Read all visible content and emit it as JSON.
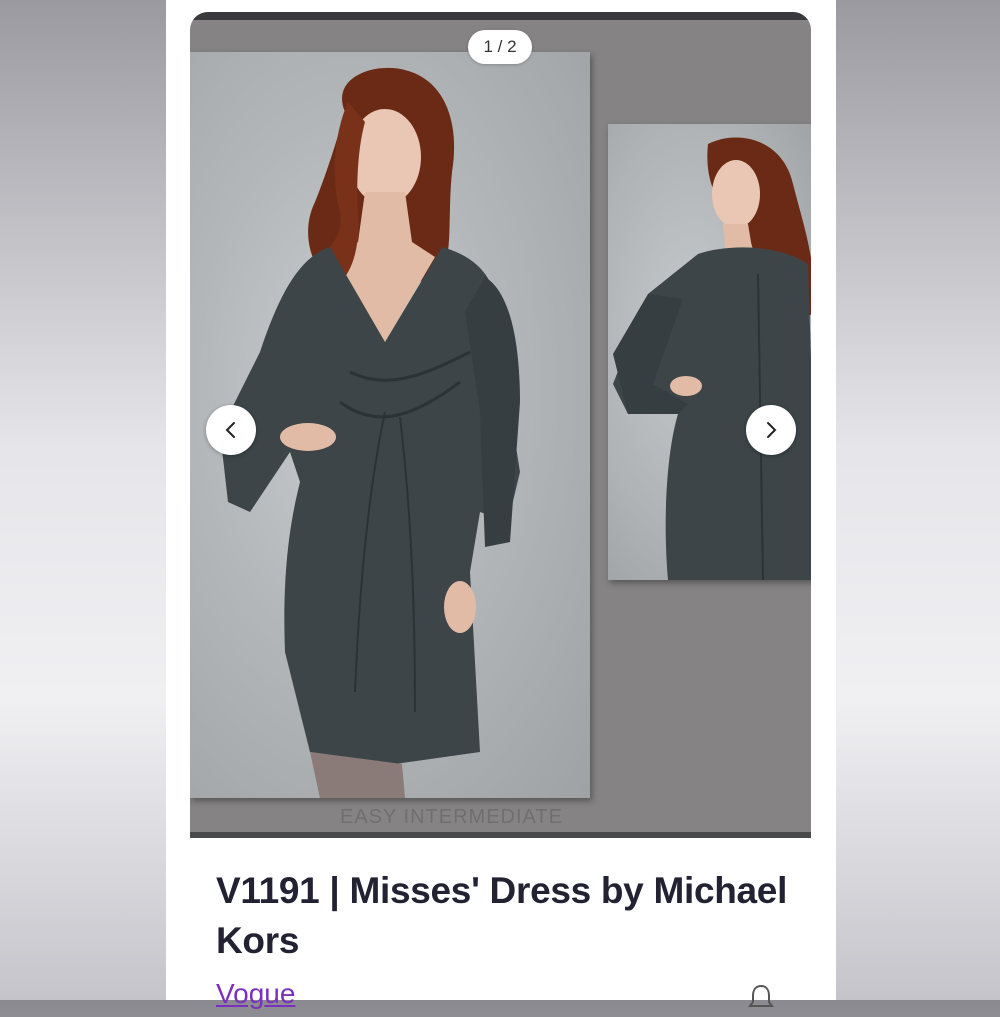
{
  "gallery": {
    "page_indicator": "1 / 2",
    "images": [
      {
        "description_icon": "dress-front-photo"
      },
      {
        "description_icon": "dress-back-photo"
      }
    ],
    "prev_icon": "chevron-left-icon",
    "next_icon": "chevron-right-icon",
    "watermark_text": "EASY INTERMEDIATE"
  },
  "product": {
    "title": "V1191 | Misses' Dress by Michael Kors",
    "brand": "Vogue",
    "notify_icon": "bell-icon"
  },
  "colors": {
    "title": "#222233",
    "brand_link": "#7a2fbe",
    "dress": "#3d4548",
    "hair": "#6b2a16"
  }
}
